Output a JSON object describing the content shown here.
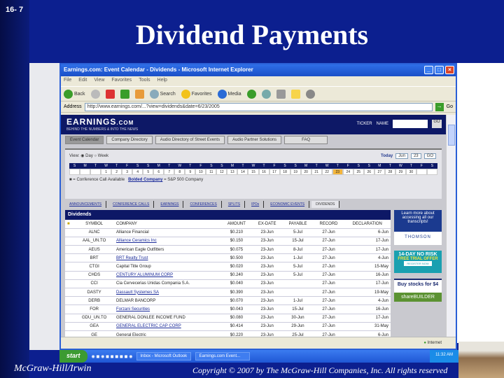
{
  "slide": {
    "number": "16- 7",
    "title": "Dividend Payments",
    "footer_left": "McGraw-Hill/Irwin",
    "footer_right": "Copyright © 2007 by The McGraw-Hill Companies, Inc. All rights reserved"
  },
  "browser": {
    "title": "Earnings.com: Event Calendar - Dividends - Microsoft Internet Explorer",
    "menu": [
      "File",
      "Edit",
      "View",
      "Favorites",
      "Tools",
      "Help"
    ],
    "toolbar": {
      "back": "Back",
      "search": "Search",
      "favorites": "Favorites",
      "media": "Media"
    },
    "address_label": "Address",
    "address": "http://www.earnings.com/...?view=dividends&date=6/23/2005",
    "go": "Go",
    "status": "Internet"
  },
  "site": {
    "logo": "EARNINGS",
    "logo_suffix": ".COM",
    "tagline": "BEHIND THE NUMBERS & INTO THE NEWS",
    "search": {
      "ticker": "TICKER",
      "name": "NAME",
      "go": "GO"
    },
    "nav": [
      "Event Calendar",
      "Company Directory",
      "Audio Directory of Street Events",
      "Audio Partner Solutions",
      "FAQ"
    ],
    "view_label": "View:",
    "view_day": "Day",
    "view_week": "Week",
    "today": "Today",
    "month": "Jun",
    "day": "23",
    "go": "GO",
    "cal_days": [
      "S",
      "M",
      "T",
      "W",
      "T",
      "F",
      "S",
      "S",
      "M",
      "T",
      "W",
      "T",
      "F",
      "S",
      "S",
      "M",
      "T",
      "W",
      "T",
      "F",
      "S",
      "S",
      "M",
      "T",
      "W",
      "T",
      "F",
      "S",
      "S",
      "M",
      "T",
      "W",
      "T",
      "F",
      "S"
    ],
    "cal_dates": [
      "",
      "",
      "",
      "1",
      "2",
      "3",
      "4",
      "5",
      "6",
      "7",
      "8",
      "9",
      "10",
      "11",
      "12",
      "13",
      "14",
      "15",
      "16",
      "17",
      "18",
      "19",
      "20",
      "21",
      "22",
      "23",
      "24",
      "25",
      "26",
      "27",
      "28",
      "29",
      "30",
      "",
      ""
    ],
    "legend_text": "= Conference Call Available",
    "legend_link": "Bolded Company",
    "legend_suffix": "= S&P 500 Company",
    "subtabs": [
      "ANNOUNCEMENTS",
      "CONFERENCE CALLS",
      "EARNINGS",
      "CONFERENCES",
      "SPLITS",
      "IPOs",
      "ECONOMIC EVENTS",
      "DIVIDENDS"
    ],
    "table": {
      "title": "Dividends",
      "headers": [
        "SYMBOL",
        "COMPANY",
        "AMOUNT",
        "EX-DATE",
        "PAYABLE",
        "RECORD",
        "DECLARATION"
      ],
      "rows": [
        [
          "ALNC",
          "Alliance Financial",
          "$0.210",
          "23-Jun",
          "5-Jul",
          "27-Jun",
          "6-Jun"
        ],
        [
          "AAL_UN.TO",
          "Alliance Ceramics Inc",
          "$0.150",
          "23-Jun",
          "15-Jul",
          "27-Jun",
          "17-Jun"
        ],
        [
          "AEUS",
          "American Eagle Outfitters",
          "$0.075",
          "23-Jun",
          "8-Jul",
          "27-Jun",
          "17-Jun"
        ],
        [
          "BRT",
          "BRT Realty Trust",
          "$0.500",
          "23-Jun",
          "1-Jul",
          "27-Jun",
          "4-Jun"
        ],
        [
          "CTGI",
          "Capital Title Group",
          "$0.020",
          "23-Jun",
          "5-Jul",
          "27-Jun",
          "15-May"
        ],
        [
          "CHDS",
          "CENTURY ALUMINUM CORP",
          "$0.240",
          "23-Jun",
          "5-Jul",
          "27-Jun",
          "16-Jun"
        ],
        [
          "CCI",
          "Cia Cervecerias Unidas Compania S.A.",
          "$0.040",
          "23-Jun",
          "",
          "27-Jun",
          "17-Jun"
        ],
        [
          "DASTY",
          "Dassault Systemes SA",
          "$0.390",
          "23-Jun",
          "",
          "27-Jun",
          "19-May"
        ],
        [
          "DERB",
          "DELMAR BANCORP",
          "$0.070",
          "23-Jun",
          "1-Jul",
          "27-Jun",
          "4-Jun"
        ],
        [
          "FOR",
          "Forzani Securities",
          "$0.043",
          "23-Jun",
          "15-Jul",
          "27-Jun",
          "16-Jun"
        ],
        [
          "GDU_UN.TO",
          "GENERAL DONLEE INCOME FUND",
          "$0.080",
          "23-Jun",
          "30-Jun",
          "27-Jun",
          "17-Jun"
        ],
        [
          "GEA",
          "GENERAL ELECTRIC CAP CORP",
          "$0.414",
          "23-Jun",
          "29-Jun",
          "27-Jun",
          "31-May"
        ],
        [
          "GE",
          "General Electric",
          "$0.220",
          "23-Jun",
          "25-Jul",
          "27-Jun",
          "6-Jun"
        ]
      ]
    },
    "ads": {
      "thomson_text": "Learn more about accessing all our transcripts!",
      "thomson_logo": "THOMSON",
      "trial_a": "14-DAY NO RISK",
      "trial_b": "FREE TRIAL OFFER",
      "trial_c": "REGISTER NOW",
      "sb_a": "Buy stocks for $4",
      "sb_b": "shareBUILDER"
    }
  },
  "taskbar": {
    "start": "start",
    "tasks": [
      "Inbox - Microsoft Outlook",
      "Earnings.com Event..."
    ],
    "clock": "11:32 AM"
  }
}
